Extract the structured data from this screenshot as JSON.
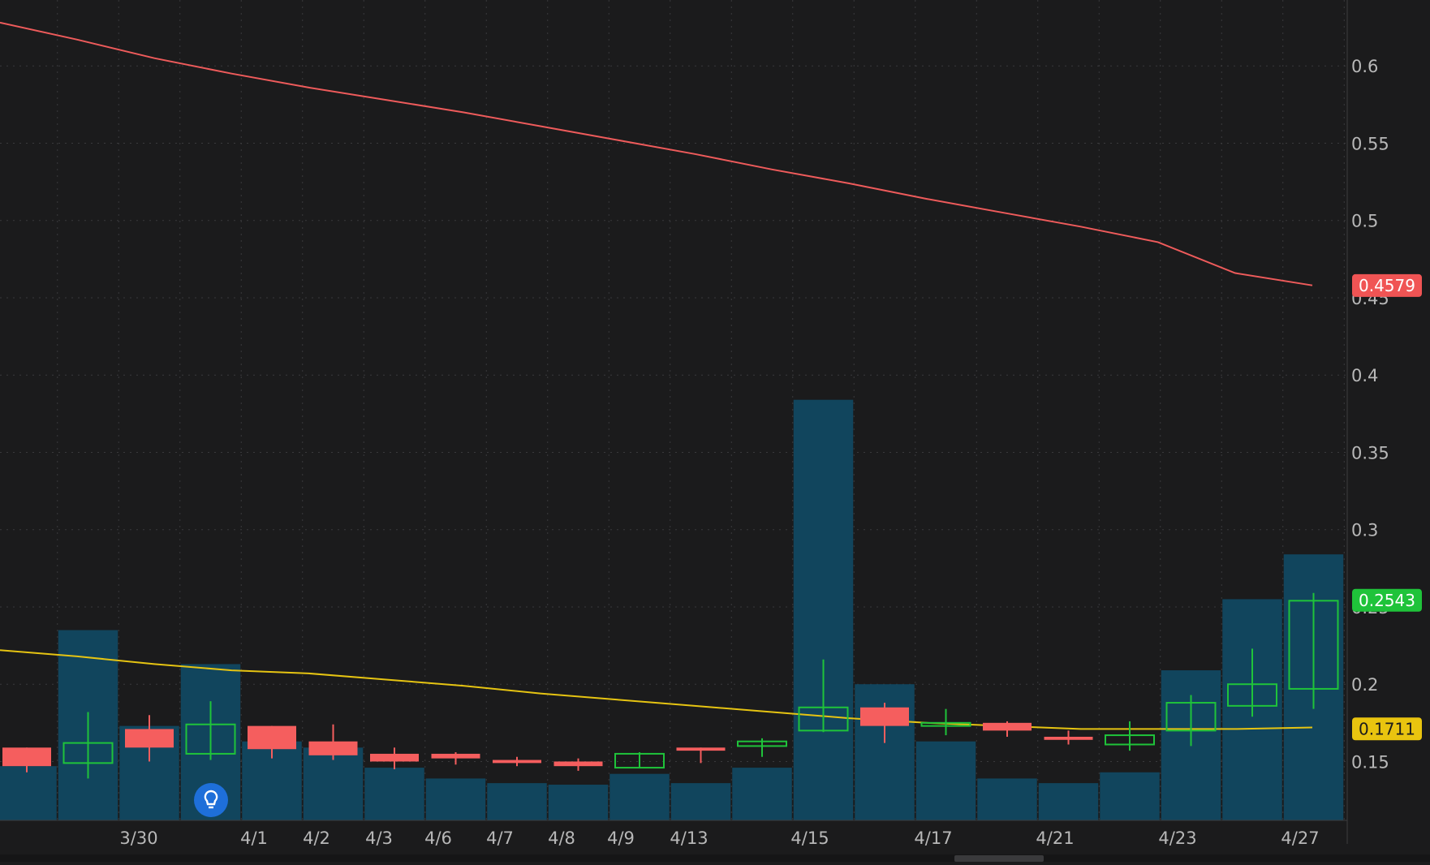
{
  "chart_data": {
    "type": "candlestick",
    "x_ticks": [
      "3/30",
      "4/1",
      "4/2",
      "4/3",
      "4/6",
      "4/7",
      "4/8",
      "4/9",
      "4/13",
      "4/15",
      "4/17",
      "4/21",
      "4/23",
      "4/27"
    ],
    "y_ticks": [
      "0.6",
      "0.55",
      "0.5",
      "0.45",
      "0.4",
      "0.35",
      "0.3",
      "0.25",
      "0.2",
      "0.15"
    ],
    "ylim": [
      0.12,
      0.65
    ],
    "grid": true,
    "candles": [
      {
        "open": 0.159,
        "high": 0.159,
        "low": 0.143,
        "close": 0.147
      },
      {
        "open": 0.149,
        "high": 0.182,
        "low": 0.139,
        "close": 0.162
      },
      {
        "open": 0.171,
        "high": 0.18,
        "low": 0.15,
        "close": 0.159
      },
      {
        "open": 0.155,
        "high": 0.189,
        "low": 0.151,
        "close": 0.174
      },
      {
        "open": 0.173,
        "high": 0.173,
        "low": 0.152,
        "close": 0.158
      },
      {
        "open": 0.163,
        "high": 0.174,
        "low": 0.151,
        "close": 0.154
      },
      {
        "open": 0.155,
        "high": 0.159,
        "low": 0.145,
        "close": 0.15
      },
      {
        "open": 0.155,
        "high": 0.156,
        "low": 0.148,
        "close": 0.152
      },
      {
        "open": 0.151,
        "high": 0.153,
        "low": 0.147,
        "close": 0.149
      },
      {
        "open": 0.15,
        "high": 0.152,
        "low": 0.144,
        "close": 0.147
      },
      {
        "open": 0.146,
        "high": 0.156,
        "low": 0.146,
        "close": 0.155
      },
      {
        "open": 0.159,
        "high": 0.159,
        "low": 0.149,
        "close": 0.157
      },
      {
        "open": 0.16,
        "high": 0.165,
        "low": 0.153,
        "close": 0.163
      },
      {
        "open": 0.17,
        "high": 0.216,
        "low": 0.169,
        "close": 0.185
      },
      {
        "open": 0.185,
        "high": 0.188,
        "low": 0.162,
        "close": 0.173
      },
      {
        "open": 0.173,
        "high": 0.184,
        "low": 0.167,
        "close": 0.175
      },
      {
        "open": 0.175,
        "high": 0.176,
        "low": 0.166,
        "close": 0.17
      },
      {
        "open": 0.166,
        "high": 0.17,
        "low": 0.161,
        "close": 0.164
      },
      {
        "open": 0.161,
        "high": 0.176,
        "low": 0.157,
        "close": 0.167
      },
      {
        "open": 0.17,
        "high": 0.193,
        "low": 0.16,
        "close": 0.188
      },
      {
        "open": 0.186,
        "high": 0.223,
        "low": 0.179,
        "close": 0.2
      },
      {
        "open": 0.197,
        "high": 0.259,
        "low": 0.184,
        "close": 0.254
      }
    ],
    "volume_bar_tops": [
      0.147,
      0.235,
      0.173,
      0.213,
      0.163,
      0.159,
      0.146,
      0.139,
      0.136,
      0.135,
      0.142,
      0.136,
      0.146,
      0.384,
      0.2,
      0.163,
      0.139,
      0.136,
      0.143,
      0.209,
      0.255,
      0.284
    ],
    "series": [
      {
        "values": [
          0.628,
          0.617,
          0.605,
          0.595,
          0.586,
          0.578,
          0.57,
          0.561,
          0.552,
          0.543,
          0.533,
          0.524,
          0.514,
          0.505,
          0.496,
          0.486,
          0.466,
          0.458
        ],
        "color": "#ee5b5b"
      },
      {
        "values": [
          0.222,
          0.218,
          0.213,
          0.209,
          0.207,
          0.203,
          0.199,
          0.194,
          0.19,
          0.186,
          0.182,
          0.178,
          0.175,
          0.173,
          0.171,
          0.171,
          0.171,
          0.172
        ],
        "color": "#e6c412"
      }
    ],
    "price_labels": [
      {
        "text": "0.4579",
        "value": 0.4579,
        "color": "#f05454"
      },
      {
        "text": "0.2543",
        "value": 0.2543,
        "color": "#1fc33a"
      },
      {
        "text": "0.1711",
        "value": 0.1711,
        "color": "#e9c40f"
      }
    ],
    "colors": {
      "background": "#1b1b1c",
      "grid": "#3a3a3c",
      "up": "#1fc33a",
      "down": "#f55e5e",
      "volume": "#11455d",
      "axis_text": "#b8b8b8"
    }
  },
  "icons": {
    "marker": "lightbulb-icon"
  }
}
